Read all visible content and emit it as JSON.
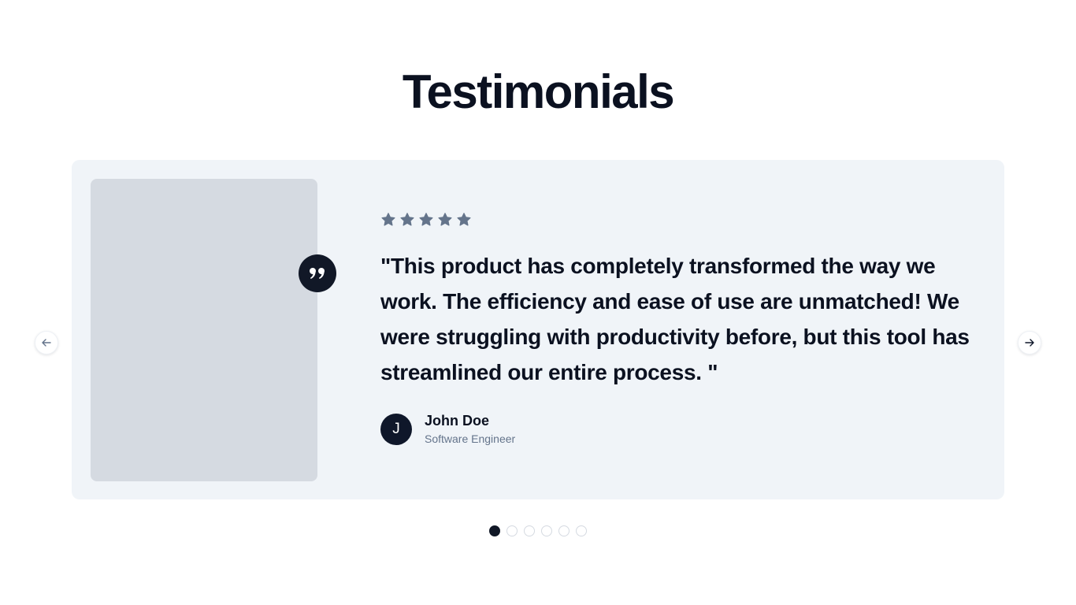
{
  "section": {
    "title": "Testimonials"
  },
  "testimonial": {
    "rating": 5,
    "max_rating": 5,
    "quote": "\"This product has completely transformed the way we work. The efficiency and ease of use are unmatched! We were struggling with productivity before, but this tool has streamlined our entire process. \"",
    "author": {
      "initial": "J",
      "name": "John Doe",
      "role": "Software Engineer"
    }
  },
  "carousel": {
    "slide_count": 6,
    "active_index": 0,
    "prev_icon": "arrow-left-icon",
    "next_icon": "arrow-right-icon"
  },
  "colors": {
    "card_bg": "#f0f4f8",
    "photo_placeholder": "#d5dae1",
    "star": "#64748b",
    "accent_dark": "#111827",
    "muted_text": "#64748b"
  }
}
